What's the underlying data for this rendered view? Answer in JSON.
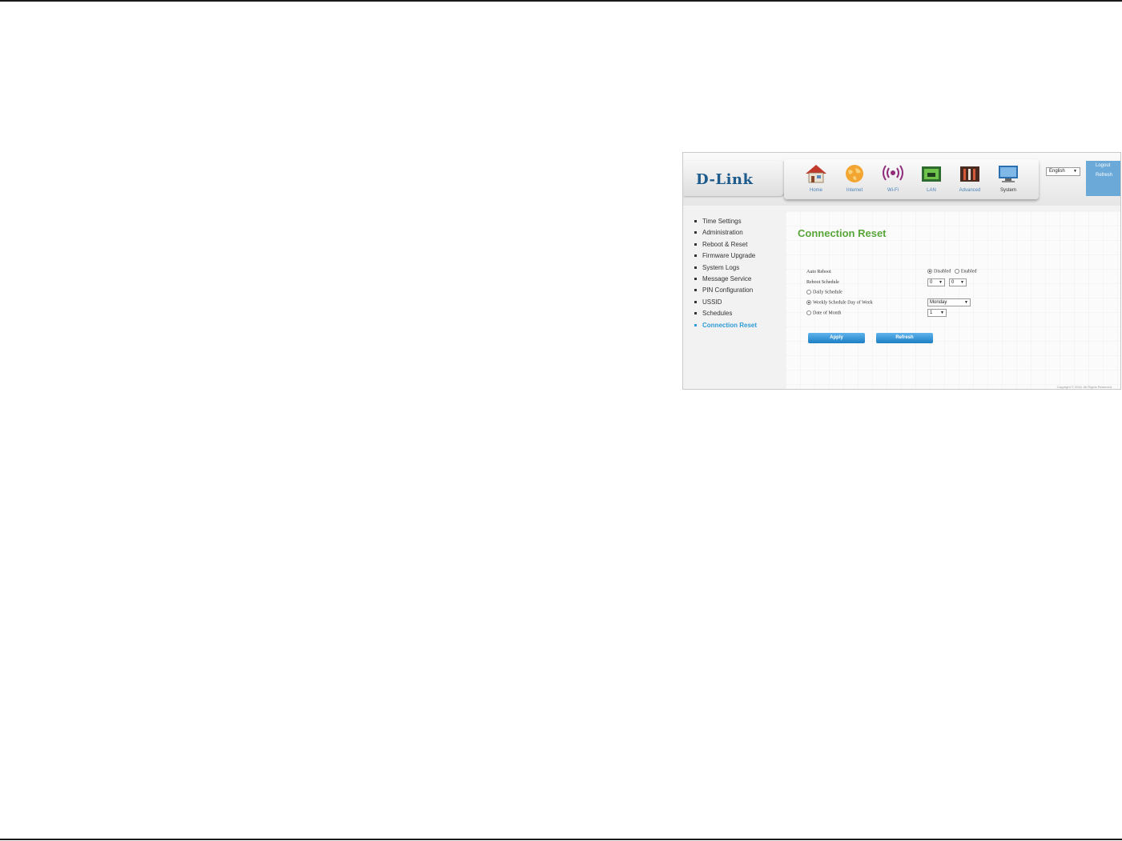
{
  "brand": {
    "logo": "D-Link"
  },
  "nav": {
    "items": [
      {
        "label": "Home",
        "icon": "home-icon"
      },
      {
        "label": "Internet",
        "icon": "globe-icon"
      },
      {
        "label": "Wi-Fi",
        "icon": "wifi-icon"
      },
      {
        "label": "LAN",
        "icon": "lan-icon"
      },
      {
        "label": "Advanced",
        "icon": "advanced-icon"
      },
      {
        "label": "System",
        "icon": "system-icon"
      }
    ],
    "active": "System"
  },
  "language": {
    "selected": "English"
  },
  "account": {
    "logout": "Logout",
    "refresh": "Refresh"
  },
  "sidebar": {
    "items": [
      {
        "label": "Time Settings"
      },
      {
        "label": "Administration"
      },
      {
        "label": "Reboot & Reset"
      },
      {
        "label": "Firmware Upgrade"
      },
      {
        "label": "System Logs"
      },
      {
        "label": "Message Service"
      },
      {
        "label": "PIN Configuration"
      },
      {
        "label": "USSID"
      },
      {
        "label": "Schedules"
      },
      {
        "label": "Connection Reset"
      }
    ],
    "active": "Connection Reset"
  },
  "main": {
    "title": "Connection Reset",
    "auto_reboot": {
      "label": "Auto Reboot",
      "options": [
        "Disabled",
        "Enabled"
      ],
      "selected": "Disabled"
    },
    "reboot_schedule": {
      "label": "Reboot Schedule",
      "hour": "0",
      "minute": "0"
    },
    "daily": {
      "label": "Daily Schedule",
      "checked": false
    },
    "weekly": {
      "label": "Weekly Schedule Day of Week",
      "checked": true,
      "day": "Monday"
    },
    "monthly": {
      "label": "Date of Month",
      "checked": false,
      "date": "1"
    },
    "apply_label": "Apply",
    "refresh_label": "Refresh",
    "copyright": "Copyright © 2016. All Rights Reserved."
  },
  "colors": {
    "title": "#58a63b",
    "link_active": "#2e9ad6",
    "button": "#1c7fc4",
    "logo": "#1d5b8c"
  }
}
